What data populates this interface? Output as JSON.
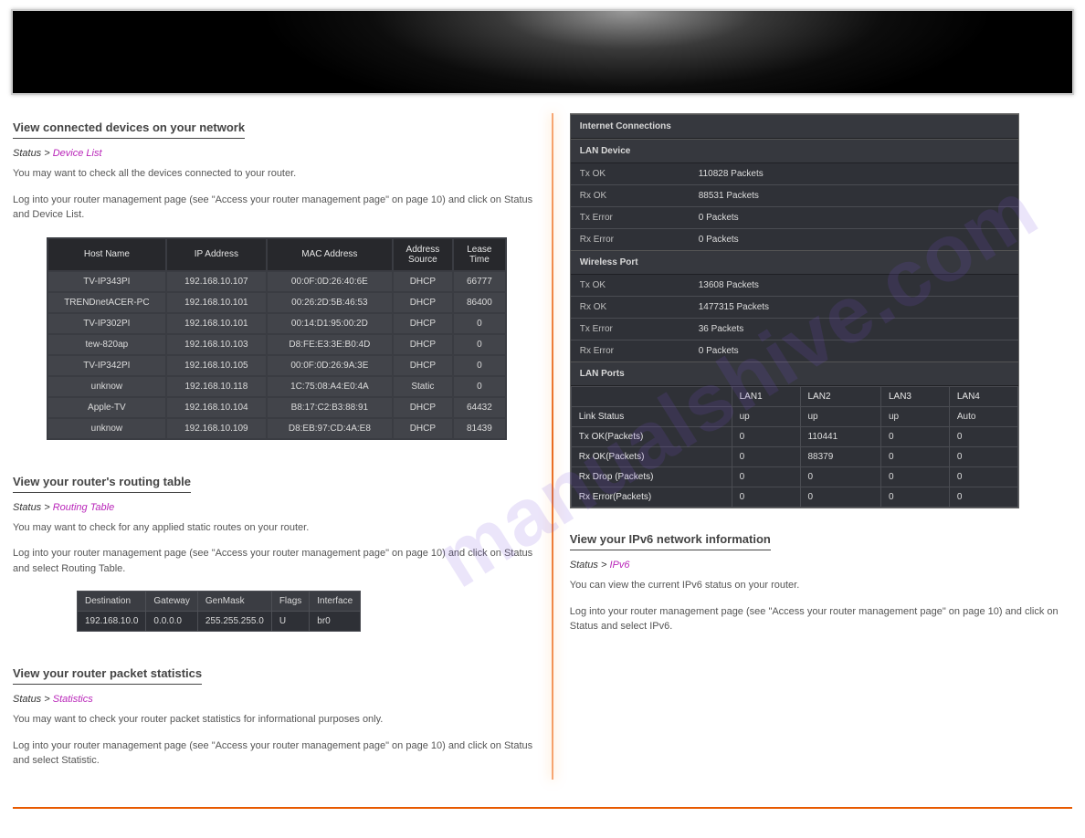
{
  "watermark": "manualshive.com",
  "sections": {
    "connected_devices": {
      "title": "View connected devices on your network",
      "nav": {
        "prefix": "Status > ",
        "highlight": "Device List"
      },
      "desc1": "You may want to check all the devices connected to your router.",
      "desc2": "Log into your router management page (see \"Access your router management page\" on page 10) and click on Status and Device List.",
      "columns": [
        "Host Name",
        "IP Address",
        "MAC Address",
        "Address Source",
        "Lease Time"
      ],
      "rows": [
        {
          "host": "TV-IP343PI",
          "ip": "192.168.10.107",
          "mac": "00:0F:0D:26:40:6E",
          "src": "DHCP",
          "lease": "66777"
        },
        {
          "host": "TRENDnetACER-PC",
          "ip": "192.168.10.101",
          "mac": "00:26:2D:5B:46:53",
          "src": "DHCP",
          "lease": "86400"
        },
        {
          "host": "TV-IP302PI",
          "ip": "192.168.10.101",
          "mac": "00:14:D1:95:00:2D",
          "src": "DHCP",
          "lease": "0"
        },
        {
          "host": "tew-820ap",
          "ip": "192.168.10.103",
          "mac": "D8:FE:E3:3E:B0:4D",
          "src": "DHCP",
          "lease": "0"
        },
        {
          "host": "TV-IP342PI",
          "ip": "192.168.10.105",
          "mac": "00:0F:0D:26:9A:3E",
          "src": "DHCP",
          "lease": "0"
        },
        {
          "host": "unknow",
          "ip": "192.168.10.118",
          "mac": "1C:75:08:A4:E0:4A",
          "src": "Static",
          "lease": "0"
        },
        {
          "host": "Apple-TV",
          "ip": "192.168.10.104",
          "mac": "B8:17:C2:B3:88:91",
          "src": "DHCP",
          "lease": "64432"
        },
        {
          "host": "unknow",
          "ip": "192.168.10.109",
          "mac": "D8:EB:97:CD:4A:E8",
          "src": "DHCP",
          "lease": "81439"
        }
      ]
    },
    "routing_table": {
      "title": "View your router's routing table",
      "nav": {
        "prefix": "Status > ",
        "highlight": "Routing Table"
      },
      "desc1": "You may want to check for any applied static routes on your router.",
      "desc2": "Log into your router management page (see \"Access your router management page\" on page 10) and click on Status and select Routing Table.",
      "columns": [
        "Destination",
        "Gateway",
        "GenMask",
        "Flags",
        "Interface"
      ],
      "rows": [
        {
          "dest": "192.168.10.0",
          "gw": "0.0.0.0",
          "mask": "255.255.255.0",
          "flags": "U",
          "if": "br0"
        }
      ]
    },
    "packet_stats": {
      "title": "View your router packet statistics",
      "nav": {
        "prefix": "Status > ",
        "highlight": "Statistics"
      },
      "desc1": "You may want to check your router packet statistics for informational purposes only.",
      "desc2": "Log into your router management page (see \"Access your router management page\" on page 10) and click on Status and select Statistic."
    },
    "ipv6": {
      "title": "View your IPv6 network information",
      "nav": {
        "prefix": "Status > ",
        "highlight": "IPv6"
      },
      "desc1": "You can view the current IPv6 status on your router.",
      "desc2": "Log into your router management page (see \"Access your router management page\" on page 10) and click on Status and select IPv6."
    }
  },
  "panel": {
    "title": "Internet Connections",
    "lan_device": {
      "name": "LAN Device",
      "rows": [
        {
          "label": "Tx OK",
          "val": "110828   Packets"
        },
        {
          "label": "Rx OK",
          "val": "88531   Packets"
        },
        {
          "label": "Tx Error",
          "val": "0   Packets"
        },
        {
          "label": "Rx Error",
          "val": "0   Packets"
        }
      ]
    },
    "wireless": {
      "name": "Wireless Port",
      "rows": [
        {
          "label": "Tx OK",
          "val": "13608   Packets"
        },
        {
          "label": "Rx OK",
          "val": "1477315   Packets"
        },
        {
          "label": "Tx Error",
          "val": "36   Packets"
        },
        {
          "label": "Rx Error",
          "val": "0   Packets"
        }
      ]
    },
    "lan_ports": {
      "name": "LAN Ports",
      "cols": [
        "",
        "LAN1",
        "LAN2",
        "LAN3",
        "LAN4"
      ],
      "rows": [
        {
          "label": "Link Status",
          "c": [
            "up",
            "up",
            "up",
            "Auto"
          ]
        },
        {
          "label": "Tx OK(Packets)",
          "c": [
            "0",
            "110441",
            "0",
            "0"
          ]
        },
        {
          "label": "Rx OK(Packets)",
          "c": [
            "0",
            "88379",
            "0",
            "0"
          ]
        },
        {
          "label": "Rx Drop (Packets)",
          "c": [
            "0",
            "0",
            "0",
            "0"
          ]
        },
        {
          "label": "Rx Error(Packets)",
          "c": [
            "0",
            "0",
            "0",
            "0"
          ]
        }
      ]
    }
  }
}
